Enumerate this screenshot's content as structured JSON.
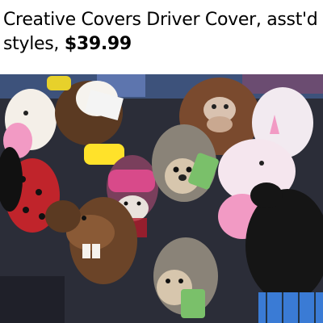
{
  "caption": {
    "text": "Creative Covers Driver Cover, asst'd styles, ",
    "price": "$39.99"
  },
  "photo": {
    "subject": "pile-of-plush-golf-driver-covers",
    "colors": {
      "background": "#2b2d38",
      "shelf": "#4a6aa8",
      "bin": "#3a7bd5",
      "owl_brown": "#5b3a22",
      "bigfoot": "#7a4a2e",
      "hedgehog": "#8a8378",
      "unicorn": "#f2eaf0",
      "pink": "#f29ac4",
      "ladybug": "#c0242b",
      "beaver": "#6b4428",
      "black_bear": "#151515",
      "monkey_hat": "#d84a8a"
    }
  }
}
